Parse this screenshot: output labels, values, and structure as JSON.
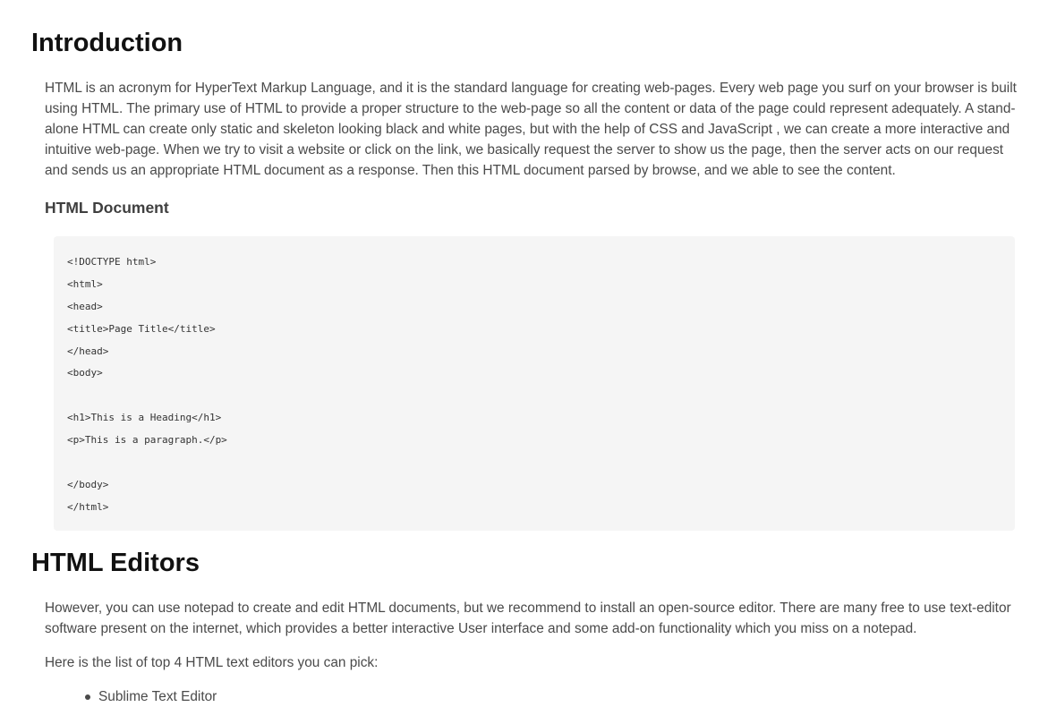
{
  "sections": [
    {
      "heading": "Introduction",
      "paragraph": "HTML is an acronym for HyperText Markup Language, and it is the standard language for creating web-pages. Every web page you surf on your browser is built using HTML. The primary use of HTML to provide a proper structure to the web-page so all the content or data of the page could represent adequately. A stand-alone HTML can create only static and skeleton looking black and white pages, but with the help of CSS and JavaScript , we can create a more interactive and intuitive web-page. When we try to visit a website or click on the link, we basically request the server to show us the page, then the server acts on our request and sends us an appropriate HTML document as a response. Then this HTML document parsed by browse, and we able to see the content.",
      "subheading": "HTML Document",
      "code_lines": [
        "<!DOCTYPE html>",
        "<html>",
        "<head>",
        "<title>Page Title</title>",
        "</head>",
        "<body>",
        "",
        "<h1>This is a Heading</h1>",
        "<p>This is a paragraph.</p>",
        "",
        "</body>",
        "</html>"
      ]
    },
    {
      "heading": "HTML Editors",
      "paragraph": "However, you can use notepad to create and edit HTML documents, but we recommend to install an open-source editor. There are many free to use text-editor software present on the internet, which provides a better interactive User interface and some add-on functionality which you miss on a notepad.",
      "list_intro": "Here is the list of top 4 HTML text editors you can pick:",
      "list_items": [
        "Sublime Text Editor"
      ]
    }
  ]
}
